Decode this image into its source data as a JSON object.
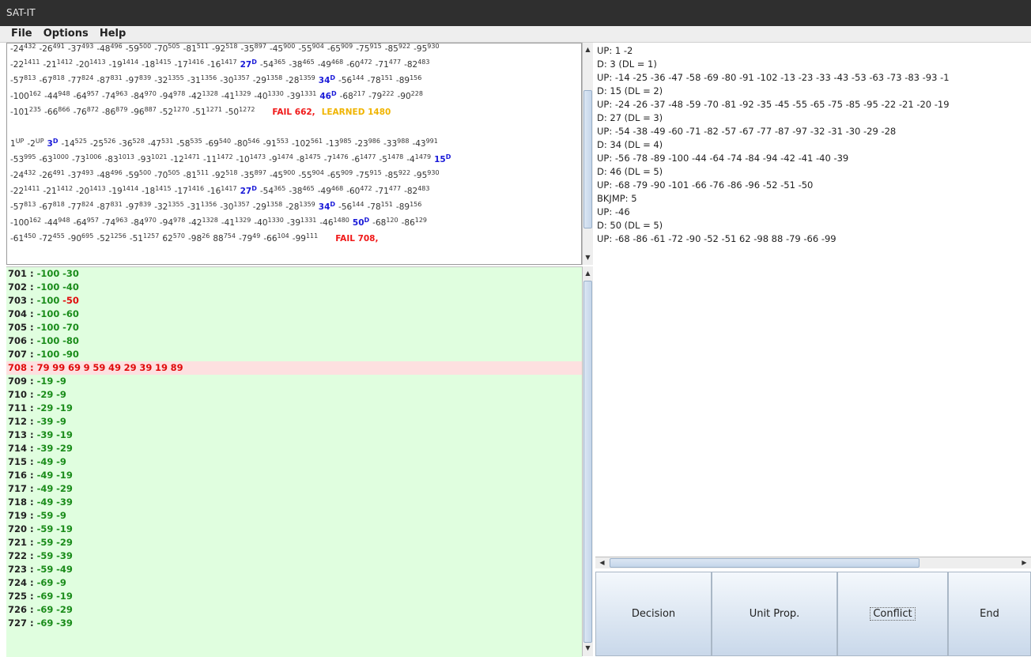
{
  "window": {
    "title": "SAT-IT"
  },
  "menu": [
    "File",
    "Options",
    "Help"
  ],
  "trail": {
    "lines": [
      {
        "parts": [
          {
            "l": "-24",
            "s": "432"
          },
          {
            "l": "-26",
            "s": "491"
          },
          {
            "l": "-37",
            "s": "493"
          },
          {
            "l": "-48",
            "s": "496"
          },
          {
            "l": "-59",
            "s": "500"
          },
          {
            "l": "-70",
            "s": "505"
          },
          {
            "l": "-81",
            "s": "511"
          },
          {
            "l": "-92",
            "s": "518"
          },
          {
            "l": "-35",
            "s": "897"
          },
          {
            "l": "-45",
            "s": "900"
          },
          {
            "l": "-55",
            "s": "904"
          },
          {
            "l": "-65",
            "s": "909"
          },
          {
            "l": "-75",
            "s": "915"
          },
          {
            "l": "-85",
            "s": "922"
          },
          {
            "l": "-95",
            "s": "930"
          }
        ]
      },
      {
        "parts": [
          {
            "l": "-22",
            "s": "1411"
          },
          {
            "l": "-21",
            "s": "1412"
          },
          {
            "l": "-20",
            "s": "1413"
          },
          {
            "l": "-19",
            "s": "1414"
          },
          {
            "l": "-18",
            "s": "1415"
          },
          {
            "l": "-17",
            "s": "1416"
          },
          {
            "l": "-16",
            "s": "1417"
          },
          {
            "l": "27",
            "s": "D",
            "dec": true
          },
          {
            "l": "-54",
            "s": "365"
          },
          {
            "l": "-38",
            "s": "465"
          },
          {
            "l": "-49",
            "s": "468"
          },
          {
            "l": "-60",
            "s": "472"
          },
          {
            "l": "-71",
            "s": "477"
          },
          {
            "l": "-82",
            "s": "483"
          }
        ]
      },
      {
        "parts": [
          {
            "l": "-57",
            "s": "813"
          },
          {
            "l": "-67",
            "s": "818"
          },
          {
            "l": "-77",
            "s": "824"
          },
          {
            "l": "-87",
            "s": "831"
          },
          {
            "l": "-97",
            "s": "839"
          },
          {
            "l": "-32",
            "s": "1355"
          },
          {
            "l": "-31",
            "s": "1356"
          },
          {
            "l": "-30",
            "s": "1357"
          },
          {
            "l": "-29",
            "s": "1358"
          },
          {
            "l": "-28",
            "s": "1359"
          },
          {
            "l": "34",
            "s": "D",
            "dec": true
          },
          {
            "l": "-56",
            "s": "144"
          },
          {
            "l": "-78",
            "s": "151"
          },
          {
            "l": "-89",
            "s": "156"
          }
        ]
      },
      {
        "parts": [
          {
            "l": "-100",
            "s": "162"
          },
          {
            "l": "-44",
            "s": "948"
          },
          {
            "l": "-64",
            "s": "957"
          },
          {
            "l": "-74",
            "s": "963"
          },
          {
            "l": "-84",
            "s": "970"
          },
          {
            "l": "-94",
            "s": "978"
          },
          {
            "l": "-42",
            "s": "1328"
          },
          {
            "l": "-41",
            "s": "1329"
          },
          {
            "l": "-40",
            "s": "1330"
          },
          {
            "l": "-39",
            "s": "1331"
          },
          {
            "l": "46",
            "s": "D",
            "dec": true
          },
          {
            "l": "-68",
            "s": "217"
          },
          {
            "l": "-79",
            "s": "222"
          },
          {
            "l": "-90",
            "s": "228"
          }
        ]
      },
      {
        "parts": [
          {
            "l": "-101",
            "s": "235"
          },
          {
            "l": "-66",
            "s": "866"
          },
          {
            "l": "-76",
            "s": "872"
          },
          {
            "l": "-86",
            "s": "879"
          },
          {
            "l": "-96",
            "s": "887"
          },
          {
            "l": "-52",
            "s": "1270"
          },
          {
            "l": "-51",
            "s": "1271"
          },
          {
            "l": "-50",
            "s": "1272"
          }
        ],
        "fail": "FAIL 662,",
        "learned": "LEARNED 1480"
      },
      {
        "parts": [
          {
            "l": "1",
            "s": "UP"
          },
          {
            "l": "-2",
            "s": "UP"
          },
          {
            "l": "3",
            "s": "D",
            "dec": true
          },
          {
            "l": "-14",
            "s": "525"
          },
          {
            "l": "-25",
            "s": "526"
          },
          {
            "l": "-36",
            "s": "528"
          },
          {
            "l": "-47",
            "s": "531"
          },
          {
            "l": "-58",
            "s": "535"
          },
          {
            "l": "-69",
            "s": "540"
          },
          {
            "l": "-80",
            "s": "546"
          },
          {
            "l": "-91",
            "s": "553"
          },
          {
            "l": "-102",
            "s": "561"
          },
          {
            "l": "-13",
            "s": "985"
          },
          {
            "l": "-23",
            "s": "986"
          },
          {
            "l": "-33",
            "s": "988"
          },
          {
            "l": "-43",
            "s": "991"
          }
        ]
      },
      {
        "parts": [
          {
            "l": "-53",
            "s": "995"
          },
          {
            "l": "-63",
            "s": "1000"
          },
          {
            "l": "-73",
            "s": "1006"
          },
          {
            "l": "-83",
            "s": "1013"
          },
          {
            "l": "-93",
            "s": "1021"
          },
          {
            "l": "-12",
            "s": "1471"
          },
          {
            "l": "-11",
            "s": "1472"
          },
          {
            "l": "-10",
            "s": "1473"
          },
          {
            "l": "-9",
            "s": "1474"
          },
          {
            "l": "-8",
            "s": "1475"
          },
          {
            "l": "-7",
            "s": "1476"
          },
          {
            "l": "-6",
            "s": "1477"
          },
          {
            "l": "-5",
            "s": "1478"
          },
          {
            "l": "-4",
            "s": "1479"
          },
          {
            "l": "15",
            "s": "D",
            "dec": true
          }
        ]
      },
      {
        "parts": [
          {
            "l": "-24",
            "s": "432"
          },
          {
            "l": "-26",
            "s": "491"
          },
          {
            "l": "-37",
            "s": "493"
          },
          {
            "l": "-48",
            "s": "496"
          },
          {
            "l": "-59",
            "s": "500"
          },
          {
            "l": "-70",
            "s": "505"
          },
          {
            "l": "-81",
            "s": "511"
          },
          {
            "l": "-92",
            "s": "518"
          },
          {
            "l": "-35",
            "s": "897"
          },
          {
            "l": "-45",
            "s": "900"
          },
          {
            "l": "-55",
            "s": "904"
          },
          {
            "l": "-65",
            "s": "909"
          },
          {
            "l": "-75",
            "s": "915"
          },
          {
            "l": "-85",
            "s": "922"
          },
          {
            "l": "-95",
            "s": "930"
          }
        ]
      },
      {
        "parts": [
          {
            "l": "-22",
            "s": "1411"
          },
          {
            "l": "-21",
            "s": "1412"
          },
          {
            "l": "-20",
            "s": "1413"
          },
          {
            "l": "-19",
            "s": "1414"
          },
          {
            "l": "-18",
            "s": "1415"
          },
          {
            "l": "-17",
            "s": "1416"
          },
          {
            "l": "-16",
            "s": "1417"
          },
          {
            "l": "27",
            "s": "D",
            "dec": true
          },
          {
            "l": "-54",
            "s": "365"
          },
          {
            "l": "-38",
            "s": "465"
          },
          {
            "l": "-49",
            "s": "468"
          },
          {
            "l": "-60",
            "s": "472"
          },
          {
            "l": "-71",
            "s": "477"
          },
          {
            "l": "-82",
            "s": "483"
          }
        ]
      },
      {
        "parts": [
          {
            "l": "-57",
            "s": "813"
          },
          {
            "l": "-67",
            "s": "818"
          },
          {
            "l": "-77",
            "s": "824"
          },
          {
            "l": "-87",
            "s": "831"
          },
          {
            "l": "-97",
            "s": "839"
          },
          {
            "l": "-32",
            "s": "1355"
          },
          {
            "l": "-31",
            "s": "1356"
          },
          {
            "l": "-30",
            "s": "1357"
          },
          {
            "l": "-29",
            "s": "1358"
          },
          {
            "l": "-28",
            "s": "1359"
          },
          {
            "l": "34",
            "s": "D",
            "dec": true
          },
          {
            "l": "-56",
            "s": "144"
          },
          {
            "l": "-78",
            "s": "151"
          },
          {
            "l": "-89",
            "s": "156"
          }
        ]
      },
      {
        "parts": [
          {
            "l": "-100",
            "s": "162"
          },
          {
            "l": "-44",
            "s": "948"
          },
          {
            "l": "-64",
            "s": "957"
          },
          {
            "l": "-74",
            "s": "963"
          },
          {
            "l": "-84",
            "s": "970"
          },
          {
            "l": "-94",
            "s": "978"
          },
          {
            "l": "-42",
            "s": "1328"
          },
          {
            "l": "-41",
            "s": "1329"
          },
          {
            "l": "-40",
            "s": "1330"
          },
          {
            "l": "-39",
            "s": "1331"
          },
          {
            "l": "-46",
            "s": "1480"
          },
          {
            "l": "50",
            "s": "D",
            "dec": true
          },
          {
            "l": "-68",
            "s": "120"
          },
          {
            "l": "-86",
            "s": "129"
          }
        ]
      },
      {
        "parts": [
          {
            "l": "-61",
            "s": "450"
          },
          {
            "l": "-72",
            "s": "455"
          },
          {
            "l": "-90",
            "s": "695"
          },
          {
            "l": "-52",
            "s": "1256"
          },
          {
            "l": "-51",
            "s": "1257"
          },
          {
            "l": "62",
            "s": "570"
          },
          {
            "l": "-98",
            "s": "26"
          },
          {
            "l": "88",
            "s": "754"
          },
          {
            "l": "-79",
            "s": "49"
          },
          {
            "l": "-66",
            "s": "104"
          },
          {
            "l": "-99",
            "s": "111"
          }
        ],
        "fail": "FAIL 708,"
      }
    ]
  },
  "log": {
    "lines": [
      "UP: 1 -2",
      "D: 3 (DL = 1)",
      "UP: -14 -25 -36 -47 -58 -69 -80 -91 -102 -13 -23 -33 -43 -53 -63 -73 -83 -93 -1",
      "D: 15 (DL = 2)",
      "UP: -24 -26 -37 -48 -59 -70 -81 -92 -35 -45 -55 -65 -75 -85 -95 -22 -21 -20 -19",
      "D: 27 (DL = 3)",
      "UP: -54 -38 -49 -60 -71 -82 -57 -67 -77 -87 -97 -32 -31 -30 -29 -28",
      "D: 34 (DL = 4)",
      "UP: -56 -78 -89 -100 -44 -64 -74 -84 -94 -42 -41 -40 -39",
      "D: 46 (DL = 5)",
      "UP: -68 -79 -90 -101 -66 -76 -86 -96 -52 -51 -50",
      "BKJMP: 5",
      "UP: -46",
      "D: 50 (DL = 5)",
      "UP: -68 -86 -61 -72 -90 -52 -51 62 -98 88 -79 -66 -99"
    ]
  },
  "clauses": [
    {
      "num": "701",
      "lits": [
        "-100",
        "-30"
      ]
    },
    {
      "num": "702",
      "lits": [
        "-100",
        "-40"
      ]
    },
    {
      "num": "703",
      "lits": [
        "-100",
        "-50"
      ],
      "red": [
        1
      ]
    },
    {
      "num": "704",
      "lits": [
        "-100",
        "-60"
      ]
    },
    {
      "num": "705",
      "lits": [
        "-100",
        "-70"
      ]
    },
    {
      "num": "706",
      "lits": [
        "-100",
        "-80"
      ]
    },
    {
      "num": "707",
      "lits": [
        "-100",
        "-90"
      ]
    },
    {
      "num": "708",
      "lits": [
        "79",
        "99",
        "69",
        "9",
        "59",
        "49",
        "29",
        "39",
        "19",
        "89"
      ],
      "conflict": true
    },
    {
      "num": "709",
      "lits": [
        "-19",
        "-9"
      ]
    },
    {
      "num": "710",
      "lits": [
        "-29",
        "-9"
      ]
    },
    {
      "num": "711",
      "lits": [
        "-29",
        "-19"
      ]
    },
    {
      "num": "712",
      "lits": [
        "-39",
        "-9"
      ]
    },
    {
      "num": "713",
      "lits": [
        "-39",
        "-19"
      ]
    },
    {
      "num": "714",
      "lits": [
        "-39",
        "-29"
      ]
    },
    {
      "num": "715",
      "lits": [
        "-49",
        "-9"
      ]
    },
    {
      "num": "716",
      "lits": [
        "-49",
        "-19"
      ]
    },
    {
      "num": "717",
      "lits": [
        "-49",
        "-29"
      ]
    },
    {
      "num": "718",
      "lits": [
        "-49",
        "-39"
      ]
    },
    {
      "num": "719",
      "lits": [
        "-59",
        "-9"
      ]
    },
    {
      "num": "720",
      "lits": [
        "-59",
        "-19"
      ]
    },
    {
      "num": "721",
      "lits": [
        "-59",
        "-29"
      ]
    },
    {
      "num": "722",
      "lits": [
        "-59",
        "-39"
      ]
    },
    {
      "num": "723",
      "lits": [
        "-59",
        "-49"
      ]
    },
    {
      "num": "724",
      "lits": [
        "-69",
        "-9"
      ]
    },
    {
      "num": "725",
      "lits": [
        "-69",
        "-19"
      ]
    },
    {
      "num": "726",
      "lits": [
        "-69",
        "-29"
      ]
    },
    {
      "num": "727",
      "lits": [
        "-69",
        "-39"
      ]
    }
  ],
  "buttons": {
    "decision": "Decision",
    "unit_prop": "Unit Prop.",
    "conflict": "Conflict",
    "end": "End"
  },
  "colors": {
    "decision_literal": "#1a1ad8",
    "fail": "#f01818",
    "learned": "#f0b400",
    "clause_bg": "#e0fedf",
    "conflict_bg": "#fde0e0"
  }
}
